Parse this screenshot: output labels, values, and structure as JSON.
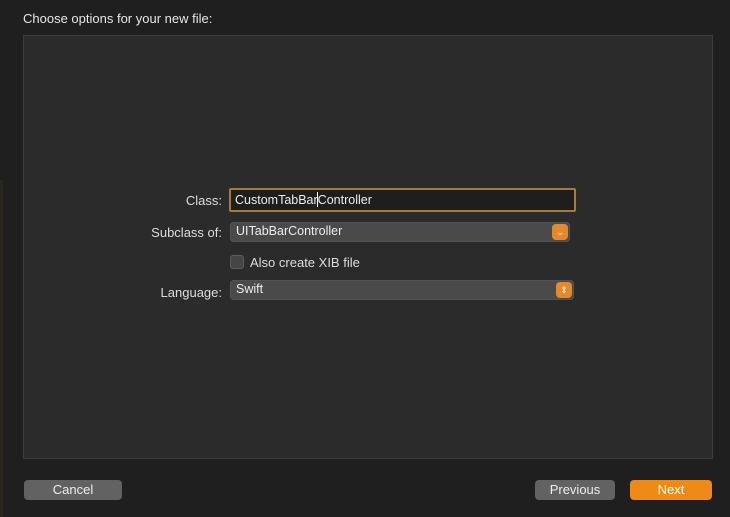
{
  "header": {
    "title": "Choose options for your new file:"
  },
  "form": {
    "class_label": "Class:",
    "class_value": "CustomTabBarController",
    "subclass_label": "Subclass of:",
    "subclass_value": "UITabBarController",
    "xib_label": "Also create XIB file",
    "xib_checked": false,
    "language_label": "Language:",
    "language_value": "Swift"
  },
  "icons": {
    "subclass_dropdown": "chevron-down-icon",
    "language_dropdown": "up-down-chevron-icon",
    "subclass_glyph": "⌄",
    "language_glyph": "⇕"
  },
  "footer": {
    "cancel_label": "Cancel",
    "previous_label": "Previous",
    "next_label": "Next"
  },
  "colors": {
    "accent": "#ef8a16",
    "focus_ring": "#a67c3c"
  }
}
